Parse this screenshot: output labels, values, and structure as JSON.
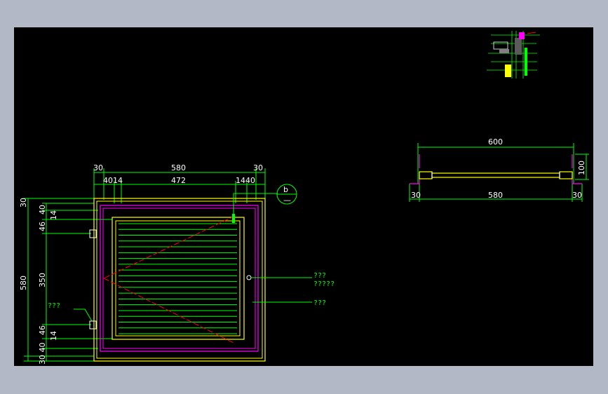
{
  "colors": {
    "background": "#000000",
    "frame": "#b3b8c6",
    "dimension": "#00ff00",
    "text": "#ffffff",
    "outline": "#ffff00",
    "magenta": "#ff00ff",
    "hidden": "#ff0000"
  },
  "front_view": {
    "top_dims": {
      "left_margin": "30",
      "overall": "580",
      "right_margin": "30",
      "sub_left": "4014",
      "inner": "472",
      "sub_right": "1440"
    },
    "left_dims": {
      "top_margin": "30",
      "overall": "580",
      "d40_top": "40",
      "d14_top": "14",
      "d46_top": "46",
      "d350": "350",
      "d46_bottom": "46",
      "d14_bottom": "14",
      "d40_bottom": "30 40",
      "bottom_margin": "30"
    },
    "detail_marker": {
      "top": "b",
      "bottom": "—"
    },
    "hinge_note": "???",
    "notes": [
      "???",
      "?????",
      "???"
    ]
  },
  "section_view": {
    "overall": "600",
    "inner": "580",
    "left": "30",
    "right": "30",
    "height": "100"
  }
}
